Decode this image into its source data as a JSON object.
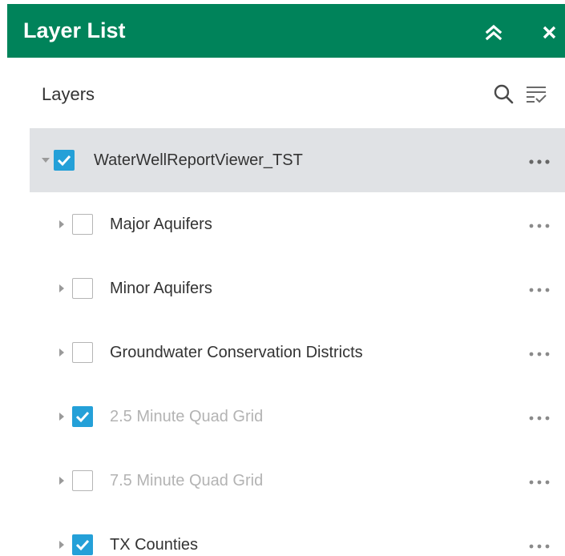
{
  "header": {
    "title": "Layer List",
    "bg_color": "#00835a"
  },
  "toolbar": {
    "title": "Layers"
  },
  "layers": [
    {
      "label": "WaterWellReportViewer_TST",
      "checked": true,
      "dimmed": false,
      "expanded": true,
      "selected": true
    },
    {
      "label": "Major Aquifers",
      "checked": false,
      "dimmed": false,
      "expanded": false,
      "selected": false
    },
    {
      "label": "Minor Aquifers",
      "checked": false,
      "dimmed": false,
      "expanded": false,
      "selected": false
    },
    {
      "label": "Groundwater Conservation Districts",
      "checked": false,
      "dimmed": false,
      "expanded": false,
      "selected": false
    },
    {
      "label": "2.5 Minute Quad Grid",
      "checked": true,
      "dimmed": true,
      "expanded": false,
      "selected": false
    },
    {
      "label": "7.5 Minute Quad Grid",
      "checked": false,
      "dimmed": true,
      "expanded": false,
      "selected": false
    },
    {
      "label": "TX Counties",
      "checked": true,
      "dimmed": false,
      "expanded": false,
      "selected": false
    }
  ],
  "colors": {
    "check_blue": "#24a0d8",
    "selected_row": "#e0e2e5",
    "dim_text": "#b3b3b3"
  }
}
